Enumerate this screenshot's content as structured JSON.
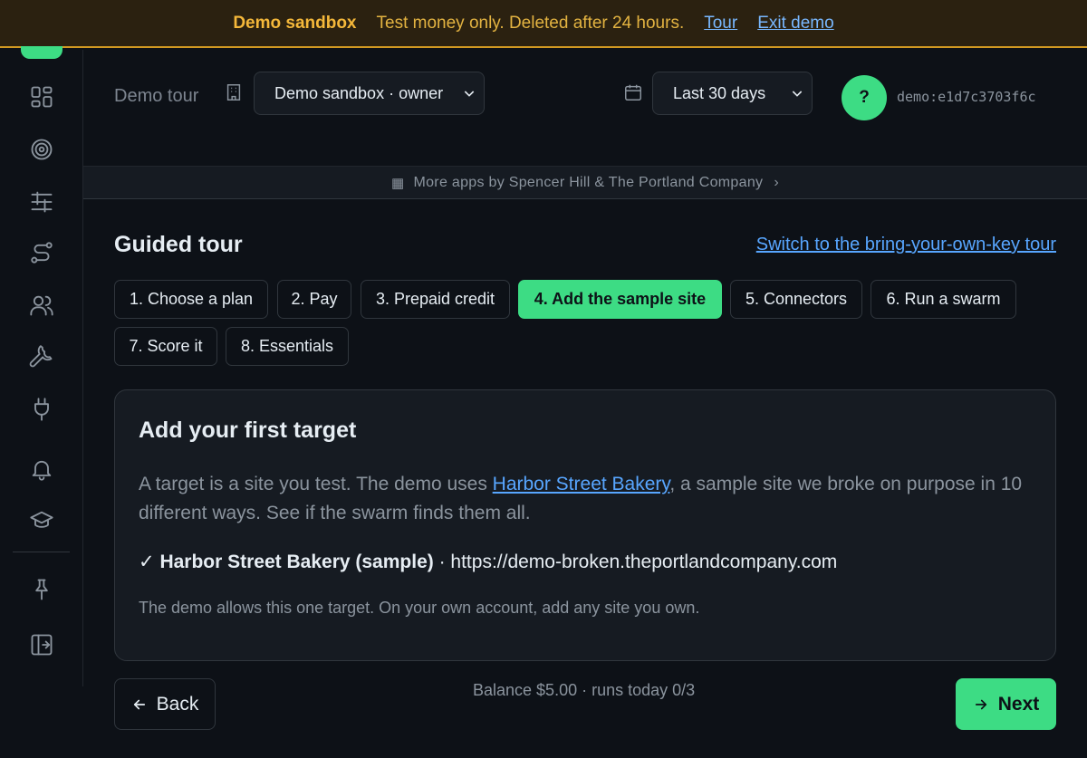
{
  "banner": {
    "title": "Demo sandbox",
    "message": "Test money only. Deleted after 24 hours.",
    "tour_link": "Tour",
    "exit_link": "Exit demo"
  },
  "sidebar": {
    "icons": [
      "dashboard-icon",
      "target-icon",
      "list-icon",
      "route-icon",
      "users-icon",
      "wrench-icon",
      "plug-icon",
      "bell-icon",
      "graduation-cap-icon",
      "pin-icon",
      "sign-out-icon"
    ]
  },
  "header": {
    "page_label": "Demo tour",
    "org_select": "Demo sandbox · owner",
    "range_select": "Last 30 days",
    "avatar_letter": "?",
    "user_id": "demo:e1d7c3703f6c"
  },
  "apps_bar": {
    "text": "More apps by Spencer Hill & The Portland Company",
    "arrow": "›"
  },
  "tour": {
    "title": "Guided tour",
    "byok_link": "Switch to the bring-your-own-key tour",
    "steps": [
      "1. Choose a plan",
      "2. Pay",
      "3. Prepaid credit",
      "4. Add the sample site",
      "5. Connectors",
      "6. Run a swarm",
      "7. Score it",
      "8. Essentials"
    ],
    "active_step": 4
  },
  "card": {
    "title": "Add your first target",
    "desc_before": "A target is a site you test. The demo uses ",
    "desc_link": "Harbor Street Bakery",
    "desc_after": ", a sample site we broke on purpose in 10 different ways. See if the swarm finds them all.",
    "check": "✓",
    "target_name": "Harbor Street Bakery (sample)",
    "target_sep": " · ",
    "target_url": "https://demo-broken.theportlandcompany.com",
    "note": "The demo allows this one target. On your own account, add any site you own."
  },
  "footer": {
    "back_label": "Back",
    "balance": "Balance $5.00 · runs today 0/3",
    "next_label": "Next"
  },
  "colors": {
    "accent": "#3ddc84",
    "banner_bg": "#2b2110",
    "banner_text": "#e3b341",
    "link": "#58a6ff"
  }
}
